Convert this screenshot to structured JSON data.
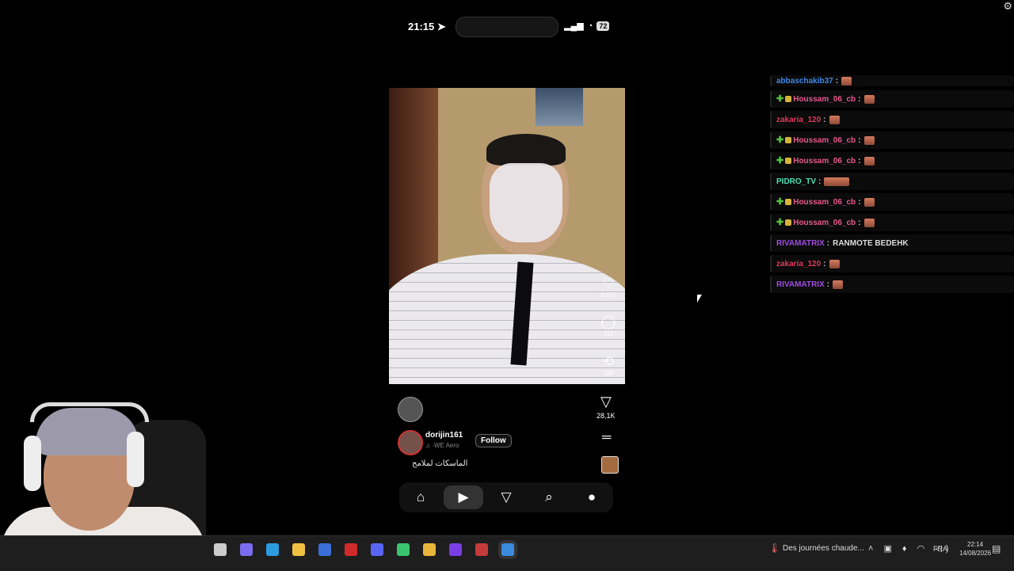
{
  "status_bar": {
    "time": "21:15",
    "battery": "72"
  },
  "video": {
    "likes": "9 678",
    "comments": "312",
    "reposts": "195",
    "shares": "28,1K"
  },
  "post": {
    "author": "dorijin161",
    "audio": "·WE  Aero",
    "follow_label": "Follow",
    "caption": "الماسكات لملامح"
  },
  "nav": {
    "items": [
      "home-icon",
      "reels-icon",
      "send-icon",
      "search-icon",
      "profile-icon"
    ],
    "active": "reels-icon"
  },
  "chat": {
    "messages": [
      {
        "user": "abbaschakib37",
        "color": "#3f87e6",
        "badges": [],
        "emote": "normal",
        "text": ""
      },
      {
        "user": "Houssam_06_cb",
        "color": "#e8588d",
        "badges": [
          "plus",
          "crown"
        ],
        "emote": "normal",
        "text": ""
      },
      {
        "user": "zakaria_120",
        "color": "#e0385a",
        "badges": [],
        "emote": "normal",
        "text": ""
      },
      {
        "user": "Houssam_06_cb",
        "color": "#e8588d",
        "badges": [
          "plus",
          "crown"
        ],
        "emote": "normal",
        "text": ""
      },
      {
        "user": "Houssam_06_cb",
        "color": "#e8588d",
        "badges": [
          "plus",
          "crown"
        ],
        "emote": "normal",
        "text": ""
      },
      {
        "user": "PIDRO_TV",
        "color": "#4be0b4",
        "badges": [],
        "emote": "wide",
        "text": ""
      },
      {
        "user": "Houssam_06_cb",
        "color": "#e8588d",
        "badges": [
          "plus",
          "crown"
        ],
        "emote": "normal",
        "text": ""
      },
      {
        "user": "Houssam_06_cb",
        "color": "#e8588d",
        "badges": [
          "plus",
          "crown"
        ],
        "emote": "normal",
        "text": ""
      },
      {
        "user": "RIVAMATRIX",
        "color": "#a04de0",
        "badges": [],
        "emote": "none",
        "text": "RANMOTE BEDEHK"
      },
      {
        "user": "zakaria_120",
        "color": "#e0385a",
        "badges": [],
        "emote": "normal",
        "text": ""
      },
      {
        "user": "RIVAMATRIX",
        "color": "#a04de0",
        "badges": [],
        "emote": "normal",
        "text": ""
      }
    ]
  },
  "taskbar": {
    "apps": [
      "task-view-icon",
      "copilot-icon",
      "edge-icon",
      "file-explorer-icon",
      "store-icon",
      "app-red-icon",
      "discord-icon",
      "game-icon",
      "chrome-icon",
      "app-purple-icon",
      "app-obs-icon",
      "remote-desktop-icon"
    ],
    "app_colors": [
      "#cccccc",
      "#7c6cf0",
      "#2d9be0",
      "#f0c040",
      "#3a6fd8",
      "#d02a2a",
      "#5865f2",
      "#3bc46d",
      "#e8b63a",
      "#7b3de6",
      "#c43b3b",
      "#3a8be0"
    ],
    "news": "Des journées chaude...",
    "language": "FRA",
    "time": "22:14",
    "date": "14/08/2026"
  }
}
